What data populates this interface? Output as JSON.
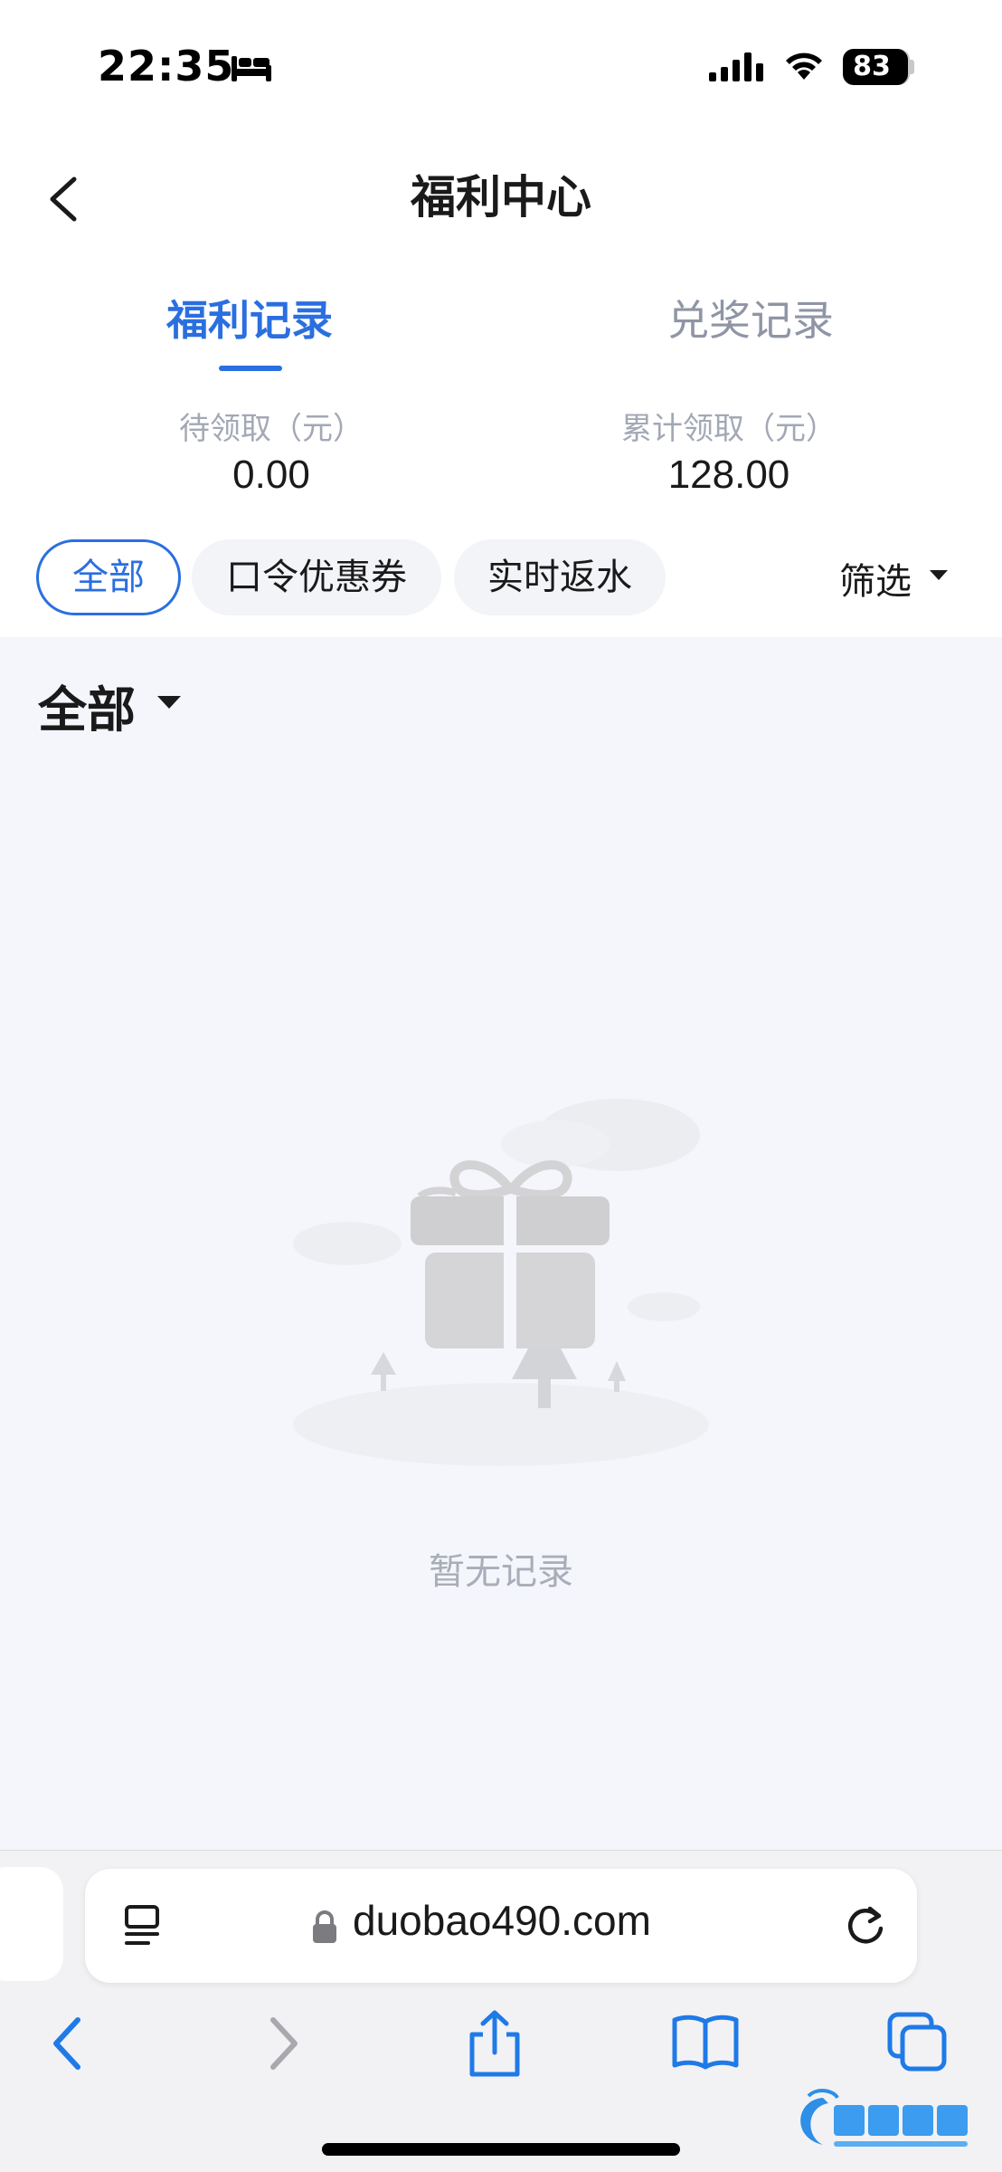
{
  "status_bar": {
    "time": "22:35",
    "battery": "83",
    "battery_level": 0.83
  },
  "nav": {
    "title": "福利中心"
  },
  "tabs": [
    {
      "label": "福利记录",
      "active": true
    },
    {
      "label": "兑奖记录",
      "active": false
    }
  ],
  "summary": {
    "pending_label": "待领取（元）",
    "pending_value": "0.00",
    "total_label": "累计领取（元）",
    "total_value": "128.00"
  },
  "filters": {
    "chips": [
      "全部",
      "口令优惠券",
      "实时返水"
    ],
    "selected": "全部",
    "filter_label": "筛选"
  },
  "section": {
    "title": "全部"
  },
  "empty_state": {
    "text": "暂无记录"
  },
  "browser": {
    "url": "duobao490.com"
  },
  "colors": {
    "accent": "#2a6fe0",
    "muted": "#8f95a5",
    "background": "#f4f6fb"
  }
}
